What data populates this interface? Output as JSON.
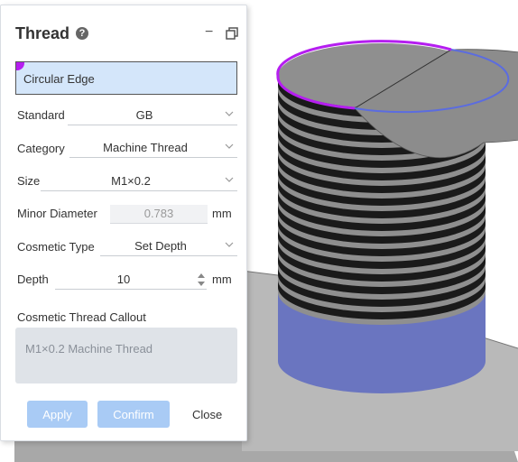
{
  "panel": {
    "title": "Thread",
    "help_glyph": "?",
    "selection": {
      "value": "Circular Edge"
    },
    "fields": {
      "standard": {
        "label": "Standard",
        "value": "GB"
      },
      "category": {
        "label": "Category",
        "value": "Machine Thread"
      },
      "size": {
        "label": "Size",
        "value": "M1×0.2"
      },
      "minor_diameter": {
        "label": "Minor Diameter",
        "value": "0.783",
        "unit": "mm"
      },
      "cosmetic_type": {
        "label": "Cosmetic Type",
        "value": "Set Depth"
      },
      "depth": {
        "label": "Depth",
        "value": "10",
        "unit": "mm"
      }
    },
    "callout": {
      "label": "Cosmetic Thread Callout",
      "text": "M1×0.2 Machine Thread"
    },
    "buttons": {
      "apply": "Apply",
      "confirm": "Confirm",
      "close": "Close"
    }
  },
  "colors": {
    "selection_highlight": "#b51ef0",
    "selected_field_bg": "#d4e6fa",
    "disabled_button": "#a9cbf5",
    "thread_dark": "#1a1a1a",
    "thread_light": "#8f8f8f",
    "body_blue": "#6a75c0",
    "edge_highlight": "#b51ef0",
    "edge_preview": "#5b6ce0"
  },
  "icons": [
    "help-icon",
    "minimize-icon",
    "restore-icon",
    "chevron-down-icon",
    "spinner-icon"
  ]
}
